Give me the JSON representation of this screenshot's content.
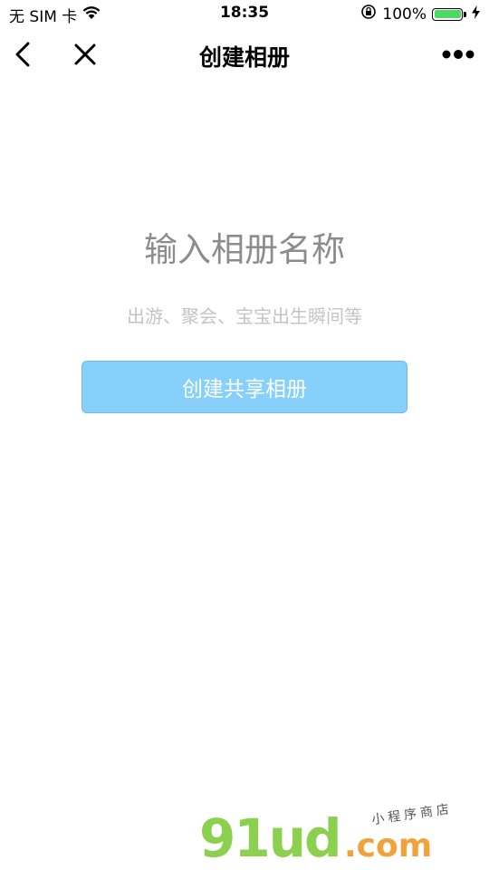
{
  "status_bar": {
    "carrier": "无 SIM 卡",
    "time": "18:35",
    "battery_percent": "100%",
    "battery_level": 1.0,
    "icons": [
      "wifi-icon",
      "rotation-lock-icon",
      "battery-icon",
      "charging-icon"
    ]
  },
  "nav": {
    "title": "创建相册",
    "back_icon": "chevron-left-icon",
    "close_icon": "close-icon",
    "more_icon": "more-icon"
  },
  "form": {
    "album_name_placeholder": "输入相册名称",
    "album_name_value": "",
    "hint": "出游、聚会、宝宝出生瞬间等",
    "create_button_label": "创建共享相册"
  },
  "colors": {
    "button_bg": "#86d0fb",
    "hint_text": "#c4c4c4",
    "placeholder": "#8c8c8c",
    "battery_fill": "#4cd964"
  },
  "watermark": {
    "logo": "91ud",
    "domain": ".com",
    "slogan": "小程序商店"
  }
}
